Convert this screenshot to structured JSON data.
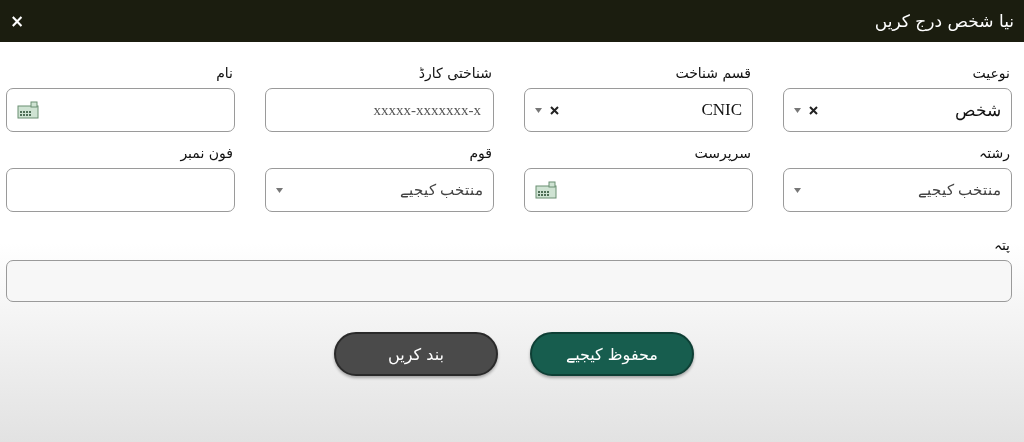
{
  "window": {
    "title": "نیا شخص درج کریں",
    "close": "×"
  },
  "fields": [
    {
      "kind": "select",
      "label": "نوعیت",
      "value": "شخص",
      "clearable": true
    },
    {
      "kind": "select",
      "label": "قسم شناخت",
      "value": "CNIC",
      "clearable": true
    },
    {
      "kind": "text",
      "label": "شناختی کارڈ",
      "placeholder": "xxxxx-xxxxxxx-x",
      "keyboard": false
    },
    {
      "kind": "text",
      "label": "نام",
      "keyboard": true
    },
    {
      "kind": "select",
      "label": "رشتہ",
      "placeholder": "منتخب کیجیے",
      "clearable": false
    },
    {
      "kind": "text",
      "label": "سرپرست",
      "keyboard": true
    },
    {
      "kind": "select",
      "label": "قوم",
      "placeholder": "منتخب کیجیے",
      "clearable": false
    },
    {
      "kind": "text",
      "label": "فون نمبر",
      "keyboard": false
    },
    {
      "kind": "wide",
      "label": "پتہ"
    }
  ],
  "buttons": [
    {
      "label": "محفوظ کیجیے",
      "kind": "primary"
    },
    {
      "label": "بند کریں",
      "kind": "secondary"
    }
  ]
}
